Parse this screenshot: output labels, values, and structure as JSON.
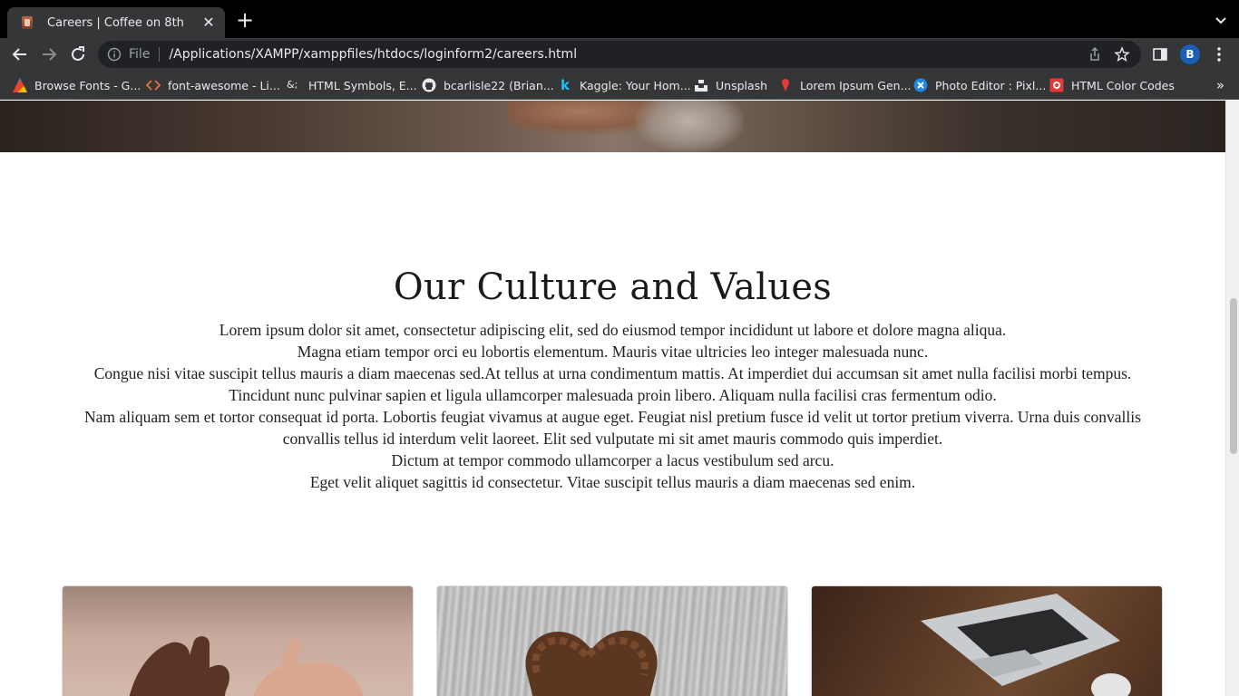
{
  "browser": {
    "tab": {
      "title": "Careers | Coffee on 8th",
      "favicon": "coffee-cup-icon"
    },
    "address": {
      "scheme_label": "File",
      "url": "/Applications/XAMPP/xamppfiles/htdocs/loginform2/careers.html"
    },
    "profile_initial": "B",
    "bookmarks": [
      {
        "label": "Browse Fonts - G...",
        "icon": "google-fonts-icon"
      },
      {
        "label": "font-awesome - Li...",
        "icon": "code-brackets-icon"
      },
      {
        "label": "HTML Symbols, E...",
        "icon": "ampersand-icon"
      },
      {
        "label": "bcarlisle22 (Brian...",
        "icon": "github-icon"
      },
      {
        "label": "Kaggle: Your Hom...",
        "icon": "kaggle-icon"
      },
      {
        "label": "Unsplash",
        "icon": "unsplash-icon"
      },
      {
        "label": "Lorem Ipsum Gen...",
        "icon": "lorem-ipsum-icon"
      },
      {
        "label": "Photo Editor : Pixl...",
        "icon": "pixlr-icon"
      },
      {
        "label": "HTML Color Codes",
        "icon": "color-codes-icon"
      }
    ],
    "bookmarks_overflow": "»"
  },
  "page": {
    "culture_heading": "Our Culture and Values",
    "culture_lines": [
      "Lorem ipsum dolor sit amet, consectetur adipiscing elit, sed do eiusmod tempor incididunt ut labore et dolore magna aliqua.",
      "Magna etiam tempor orci eu lobortis elementum. Mauris vitae ultricies leo integer malesuada nunc.",
      "Congue nisi vitae suscipit tellus mauris a diam maecenas sed.At tellus at urna condimentum mattis. At imperdiet dui accumsan sit amet nulla facilisi morbi tempus.",
      "Tincidunt nunc pulvinar sapien et ligula ullamcorper malesuada proin libero. Aliquam nulla facilisi cras fermentum odio.",
      "Nam aliquam sem et tortor consequat id porta. Lobortis feugiat vivamus at augue eget. Feugiat nisl pretium fusce id velit ut tortor pretium viverra. Urna duis convallis convallis tellus id interdum velit laoreet. Elit sed vulputate mi sit amet mauris commodo quis imperdiet.",
      "Dictum at tempor commodo ullamcorper a lacus vestibulum sed arcu.",
      "Eget velit aliquet sagittis id consectetur. Vitae suscipit tellus mauris a diam maecenas sed enim."
    ],
    "cards": [
      {
        "image": "pinky-promise-hands-photo"
      },
      {
        "image": "coffee-bean-heart-photo"
      },
      {
        "image": "laptop-on-desk-photo"
      }
    ]
  }
}
